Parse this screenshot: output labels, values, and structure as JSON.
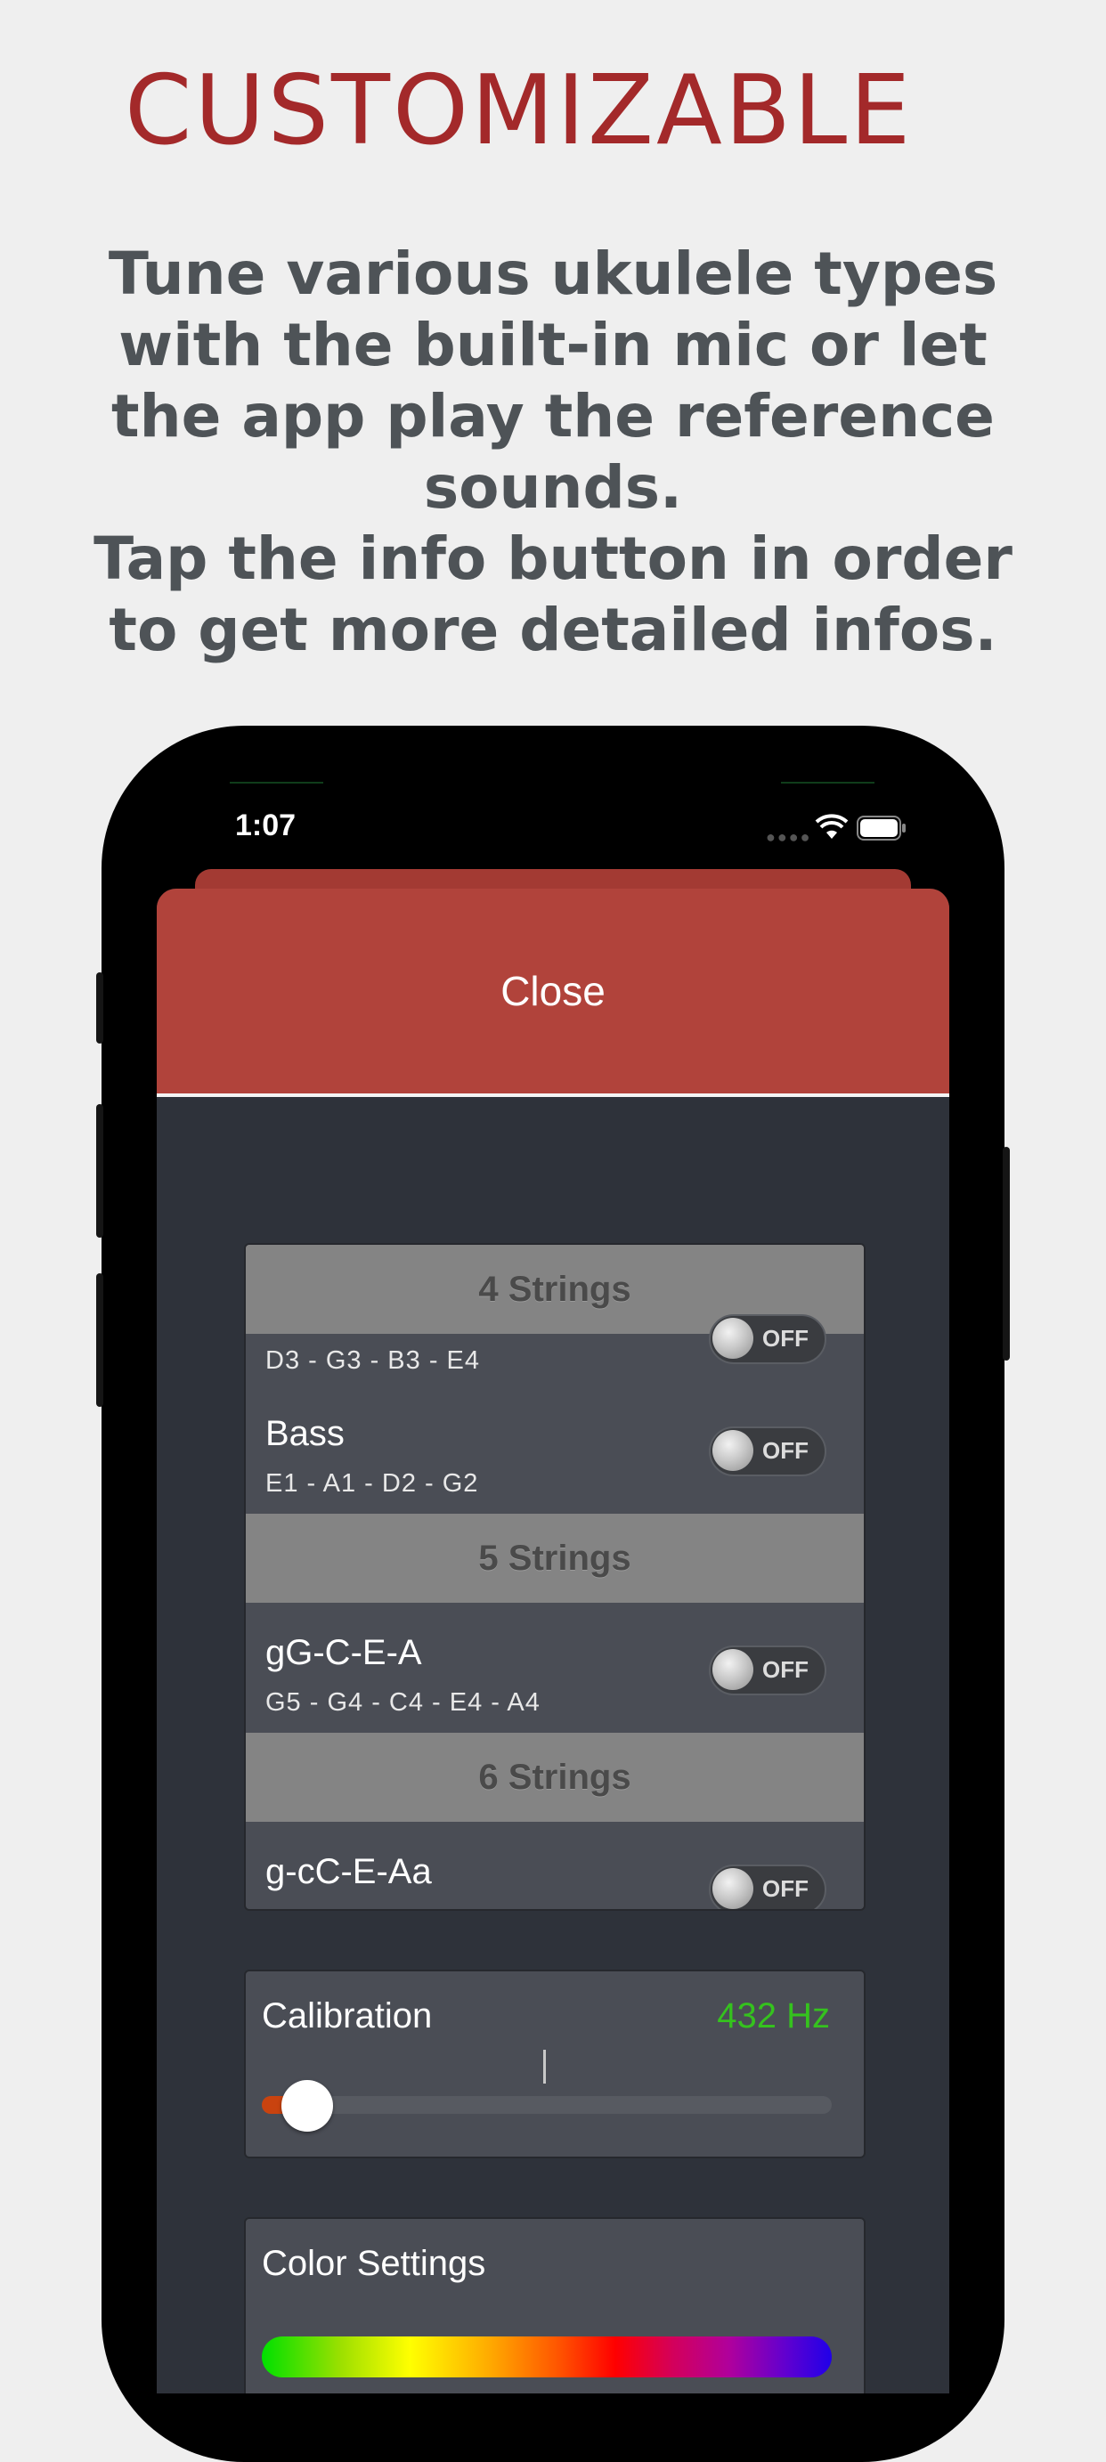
{
  "headline": "CUSTOMIZABLE",
  "subtitle_lines": [
    "Tune various ukulele types",
    "with the built-in mic or let",
    "the app play the reference",
    "sounds.",
    "Tap the info button in order",
    "to get more detailed infos."
  ],
  "status_bar": {
    "time": "1:07"
  },
  "close_label": "Close",
  "sections": [
    {
      "header": "4 Strings",
      "rows": [
        {
          "title": "",
          "notes": "D3 - G3 - B3 - E4",
          "toggle": "OFF"
        },
        {
          "title": "Bass",
          "notes": "E1 - A1 - D2 - G2",
          "toggle": "OFF"
        }
      ]
    },
    {
      "header": "5 Strings",
      "rows": [
        {
          "title": "gG-C-E-A",
          "notes": "G5 - G4 - C4 - E4 - A4",
          "toggle": "OFF"
        }
      ]
    },
    {
      "header": "6 Strings",
      "rows": [
        {
          "title": "g-cC-E-Aa",
          "notes": "",
          "toggle": "OFF"
        }
      ]
    }
  ],
  "calibration": {
    "label": "Calibration",
    "value": "432 Hz",
    "slider_fraction": 0.08
  },
  "color_settings": {
    "label": "Color Settings"
  },
  "colors": {
    "headline": "#a3292a",
    "close_bar": "#b1433b",
    "calibration_value": "#35c21e",
    "slider_fill": "#c9430f"
  }
}
